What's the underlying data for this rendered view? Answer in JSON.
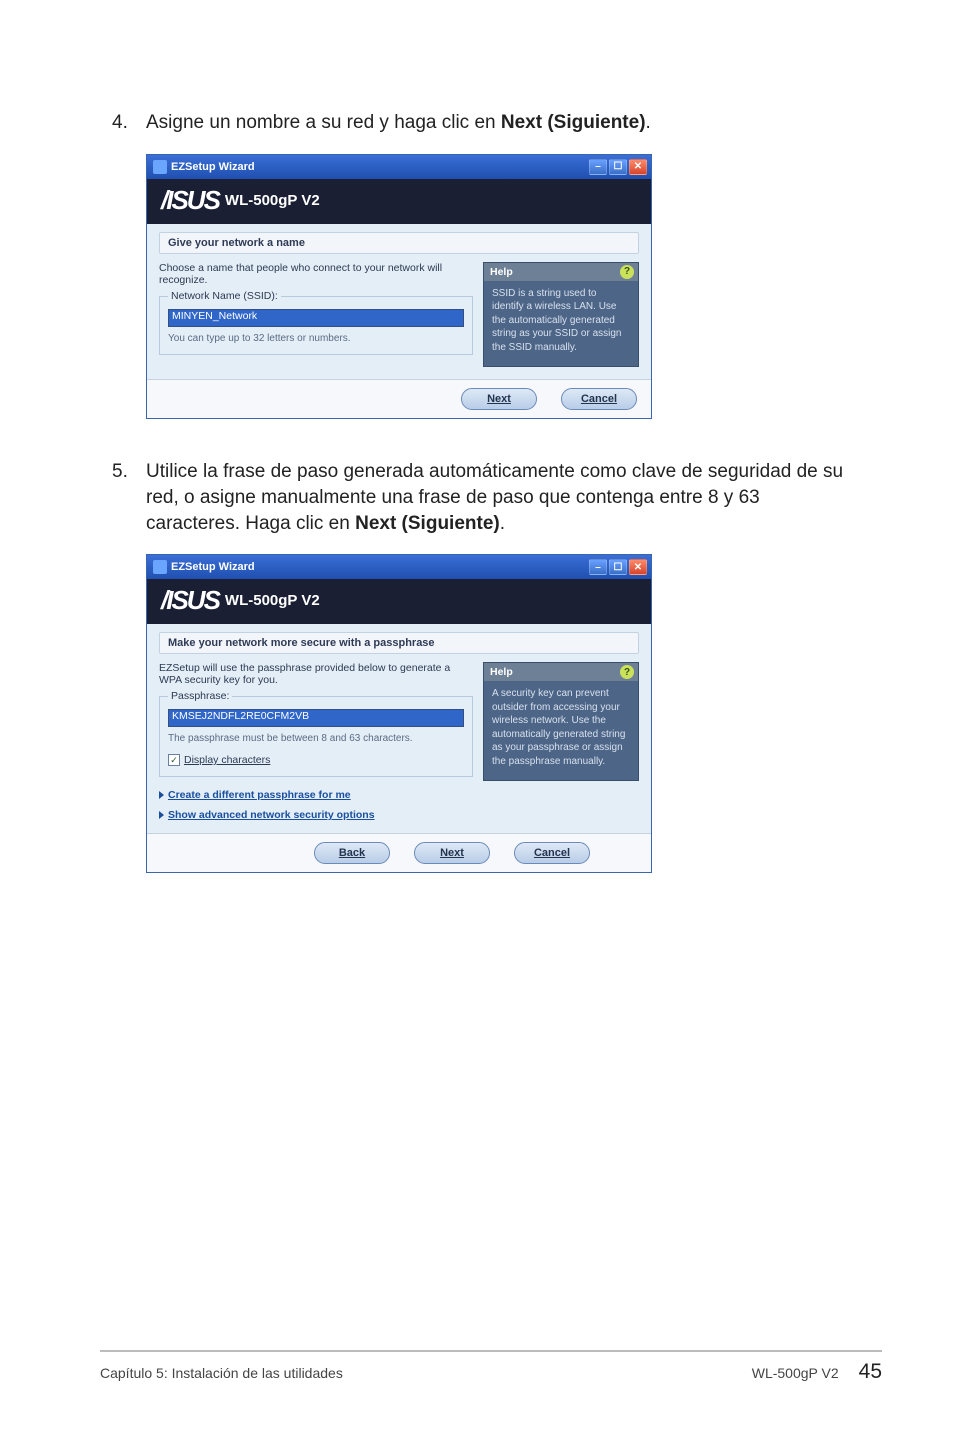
{
  "step4": {
    "num": "4.",
    "text_before": "Asigne un nombre a su red y haga clic en ",
    "text_bold": "Next (Siguiente)",
    "text_after": "."
  },
  "step5": {
    "num": "5.",
    "text_before": "Utilice la frase de paso generada automáticamente como clave de seguridad de su red, o asigne manualmente una frase de paso que contenga entre 8 y 63 caracteres. Haga clic en ",
    "text_bold": "Next (Siguiente)",
    "text_after": "."
  },
  "win_common": {
    "title": "EZSetup Wizard",
    "brand_model": "WL-500gP V2",
    "help_label": "Help",
    "help_qmark": "?",
    "next_label": "Next",
    "back_label": "Back",
    "cancel_label": "Cancel"
  },
  "win1": {
    "section_head": "Give your network a name",
    "desc": "Choose a name that people who connect to your network will recognize.",
    "field_legend": "Network Name (SSID):",
    "ssid_value": "MINYEN_Network",
    "hint": "You can type up to 32 letters or numbers.",
    "help_text": "SSID is a string used to identify a wireless LAN. Use the automatically generated string as your SSID or assign the SSID manually."
  },
  "win2": {
    "section_head": "Make your network more secure with a passphrase",
    "desc": "EZSetup will use the passphrase provided below to generate a WPA security key for you.",
    "field_legend": "Passphrase:",
    "pass_value": "KMSEJ2NDFL2RE0CFM2VB",
    "hint": "The passphrase must be between 8 and 63 characters.",
    "checkbox_label": "Display characters",
    "checkbox_mark": "✓",
    "link1": "Create a different passphrase for me",
    "link2": "Show advanced network security options",
    "help_text": "A security key can prevent outsider from accessing your wireless network. Use the automatically generated string as your passphrase or assign the passphrase manually."
  },
  "footer": {
    "left": "Capítulo 5: Instalación de las utilidades",
    "model": "WL-500gP V2",
    "page": "45"
  },
  "title_btn_glyphs": {
    "min": "–",
    "max": "☐",
    "close": "✕"
  }
}
